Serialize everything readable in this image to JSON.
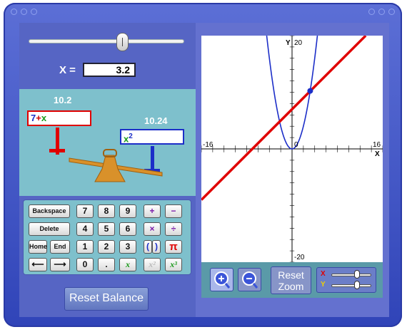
{
  "slider": {
    "x_label": "X =",
    "x_value": "3.2"
  },
  "balance": {
    "left_value": "10.2",
    "left_expr_const": "7",
    "left_expr_op": "+",
    "left_expr_var": "x",
    "right_value": "10.24",
    "right_expr_var": "x",
    "right_expr_exp": "2"
  },
  "keypad": {
    "backspace": "Backspace",
    "delete": "Delete",
    "home": "Home",
    "end": "End",
    "left_arrow": "⟵",
    "right_arrow": "⟶",
    "digits": [
      "7",
      "8",
      "9",
      "4",
      "5",
      "6",
      "1",
      "2",
      "3",
      "0"
    ],
    "dot": ".",
    "plus": "+",
    "minus": "−",
    "times": "×",
    "divide": "÷",
    "lparen": "(",
    "rparen": ")",
    "pi": "π",
    "var_x": "x",
    "var_x2": "x²",
    "var_x3": "x³"
  },
  "reset_balance": "Reset Balance",
  "graph": {
    "y_axis_label": "Y",
    "x_axis_label": "X",
    "y_max": "20",
    "y_min": "-20",
    "x_min": "-16",
    "x_max": "16",
    "origin": "0",
    "line_color": "#e00000",
    "parabola_color": "#1c2ec8"
  },
  "chart_data": {
    "type": "line",
    "xlim": [
      -16,
      16
    ],
    "ylim": [
      -20,
      20
    ],
    "series": [
      {
        "formula": "7+x",
        "color": "#e00000"
      },
      {
        "formula": "x^2",
        "color": "#1c2ec8"
      }
    ],
    "point": {
      "x": 3.2,
      "y": 10.24
    }
  },
  "zoom": {
    "reset_line1": "Reset",
    "reset_line2": "Zoom",
    "x_label": "X",
    "y_label": "Y"
  }
}
